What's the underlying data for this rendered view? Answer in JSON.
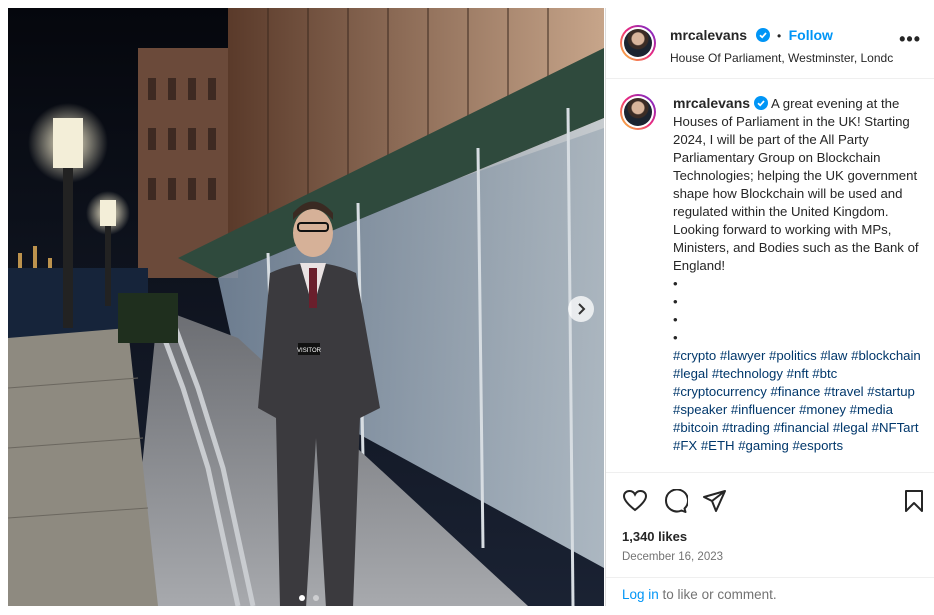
{
  "post": {
    "username": "mrcalevans",
    "follow_label": "Follow",
    "separator": "•",
    "location": "House Of Parliament, Westminster, Londc",
    "more_label": "•••"
  },
  "caption": {
    "username": "mrcalevans",
    "text": "A great evening at the Houses of Parliament in the UK! Starting 2024, I will be part of the All Party Parliamentary Group on Blockchain Technologies; helping the UK government shape how Blockchain will be used and regulated within the United Kingdom. Looking forward to working with MPs, Ministers, and Bodies such as the Bank of England!",
    "bullets": [
      "•",
      "•",
      "•",
      "•"
    ],
    "hashtags": "#crypto #lawyer #politics #law #blockchain #legal #technology #nft #btc #cryptocurrency #finance #travel #startup #speaker #influencer #money #media #bitcoin #trading #financial #legal #NFTart #FX #ETH #gaming #esports"
  },
  "stats": {
    "likes": "1,340 likes",
    "date": "December 16, 2023"
  },
  "footer": {
    "login_link": "Log in",
    "login_suffix": " to like or comment."
  },
  "media": {
    "visitor_badge": "VISITOR",
    "slide_count": 2,
    "active_slide": 1
  },
  "icons": [
    "verified-icon",
    "more-options-icon",
    "heart-icon",
    "comment-icon",
    "share-icon",
    "bookmark-icon",
    "chevron-right-icon"
  ],
  "colors": {
    "accent": "#0095f6",
    "hashtag": "#00376b",
    "text": "#262626",
    "muted": "#737373",
    "verified": "#0095f6"
  }
}
